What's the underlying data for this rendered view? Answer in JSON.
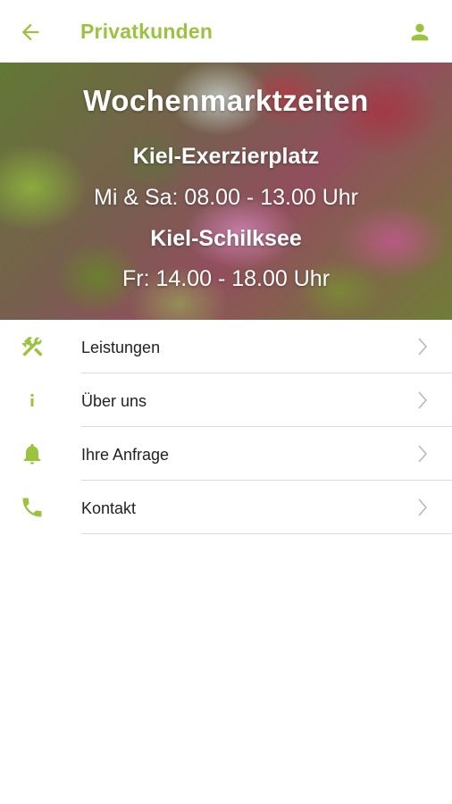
{
  "header": {
    "title": "Privatkunden",
    "back_icon": "arrow-left-icon",
    "profile_icon": "person-icon",
    "accent_color": "#9cc33f"
  },
  "hero": {
    "title": "Wochenmarktzeiten",
    "location_1": "Kiel-Exerzierplatz",
    "time_1": "Mi & Sa: 08.00 - 13.00 Uhr",
    "location_2": "Kiel-Schilksee",
    "time_2": "Fr: 14.00 - 18.00 Uhr"
  },
  "menu": {
    "items": [
      {
        "label": "Leistungen",
        "icon": "tools-icon"
      },
      {
        "label": "Über uns",
        "icon": "info-icon"
      },
      {
        "label": "Ihre Anfrage",
        "icon": "bell-icon"
      },
      {
        "label": "Kontakt",
        "icon": "phone-icon"
      }
    ],
    "chevron_icon": "chevron-right-icon"
  }
}
